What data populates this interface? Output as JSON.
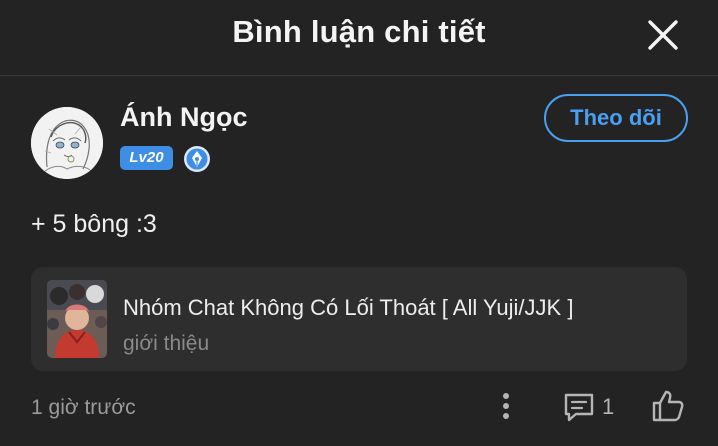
{
  "header": {
    "title": "Bình luận chi tiết",
    "close_icon": "close-icon"
  },
  "comment": {
    "author": {
      "name": "Ánh Ngọc",
      "level": "Lv20",
      "avatar_icon": "avatar",
      "badge_icon": "pen-badge-icon"
    },
    "follow_label": "Theo dõi",
    "text": "+ 5 bông :3",
    "story": {
      "title": "Nhóm Chat Không Có Lối Thoát [ All Yuji/JJK ]",
      "subtitle": "giới thiệu"
    },
    "timestamp": "1 giờ trước",
    "reply_count": "1"
  },
  "colors": {
    "background": "#232323",
    "card": "#2e2e2e",
    "accent": "#4a9ff2",
    "level_badge": "#3e8ee6"
  }
}
